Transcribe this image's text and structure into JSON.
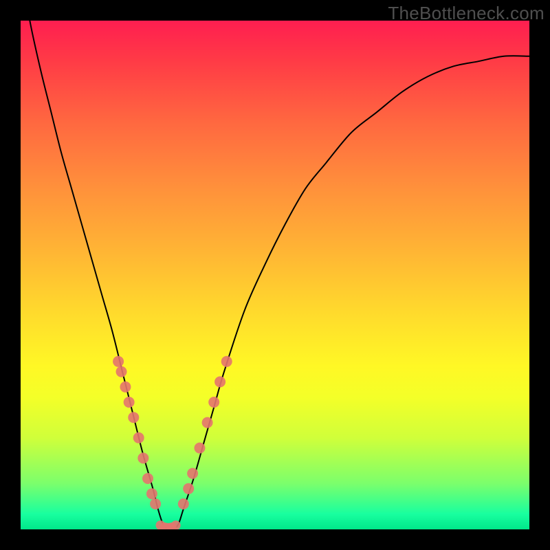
{
  "watermark_text": "TheBottleneck.com",
  "chart_data": {
    "type": "line",
    "title": "",
    "xlabel": "",
    "ylabel": "",
    "x": [
      0.0,
      0.02,
      0.04,
      0.06,
      0.08,
      0.1,
      0.12,
      0.14,
      0.16,
      0.18,
      0.2,
      0.22,
      0.24,
      0.26,
      0.27,
      0.28,
      0.29,
      0.3,
      0.31,
      0.32,
      0.34,
      0.36,
      0.38,
      0.4,
      0.44,
      0.48,
      0.52,
      0.56,
      0.6,
      0.65,
      0.7,
      0.75,
      0.8,
      0.85,
      0.9,
      0.95,
      1.0
    ],
    "y": [
      1.1,
      0.99,
      0.9,
      0.82,
      0.74,
      0.67,
      0.6,
      0.53,
      0.46,
      0.39,
      0.31,
      0.23,
      0.15,
      0.08,
      0.04,
      0.01,
      0.0,
      0.0,
      0.01,
      0.04,
      0.1,
      0.17,
      0.24,
      0.31,
      0.43,
      0.52,
      0.6,
      0.67,
      0.72,
      0.78,
      0.82,
      0.86,
      0.89,
      0.91,
      0.92,
      0.93,
      0.93
    ],
    "xlim": [
      0,
      1
    ],
    "ylim": [
      0,
      1
    ],
    "left_markers_x": [
      0.192,
      0.198,
      0.206,
      0.213,
      0.222,
      0.232,
      0.241,
      0.25,
      0.258,
      0.265
    ],
    "left_markers_y": [
      0.33,
      0.31,
      0.28,
      0.25,
      0.22,
      0.18,
      0.14,
      0.1,
      0.07,
      0.05
    ],
    "right_markers_x": [
      0.32,
      0.33,
      0.338,
      0.352,
      0.367,
      0.38,
      0.392,
      0.405
    ],
    "right_markers_y": [
      0.05,
      0.08,
      0.11,
      0.16,
      0.21,
      0.25,
      0.29,
      0.33
    ],
    "bottom_markers_x": [
      0.275,
      0.283,
      0.29,
      0.297,
      0.305
    ],
    "bottom_markers_y": [
      0.008,
      0.004,
      0.003,
      0.004,
      0.008
    ]
  }
}
